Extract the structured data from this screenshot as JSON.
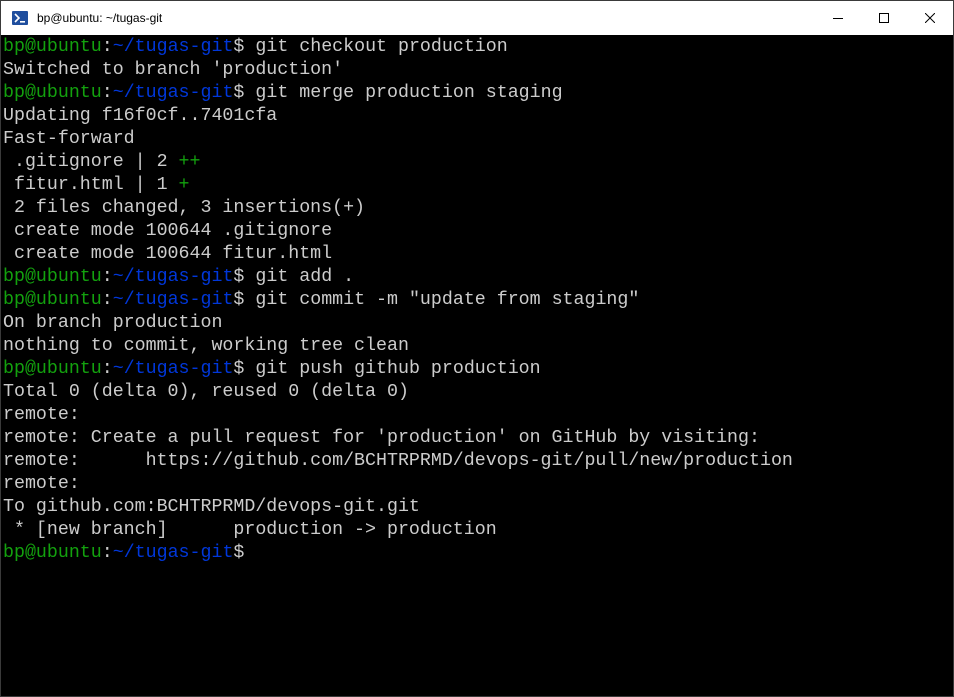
{
  "window": {
    "title": "bp@ubuntu: ~/tugas-git",
    "icon": "terminal-icon"
  },
  "prompt": {
    "user": "bp@ubuntu",
    "colon": ":",
    "path": "~/tugas-git",
    "symbol": "$"
  },
  "lines": [
    {
      "type": "cmd",
      "text": " git checkout production"
    },
    {
      "type": "out",
      "text": "Switched to branch 'production'"
    },
    {
      "type": "cmd",
      "text": " git merge production staging"
    },
    {
      "type": "out",
      "text": "Updating f16f0cf..7401cfa"
    },
    {
      "type": "out",
      "text": "Fast-forward"
    },
    {
      "type": "diff",
      "text": " .gitignore | 2 ",
      "plus": "++"
    },
    {
      "type": "diff",
      "text": " fitur.html | 1 ",
      "plus": "+"
    },
    {
      "type": "out",
      "text": " 2 files changed, 3 insertions(+)"
    },
    {
      "type": "out",
      "text": " create mode 100644 .gitignore"
    },
    {
      "type": "out",
      "text": " create mode 100644 fitur.html"
    },
    {
      "type": "cmd",
      "text": " git add ."
    },
    {
      "type": "cmd",
      "text": " git commit -m \"update from staging\""
    },
    {
      "type": "out",
      "text": "On branch production"
    },
    {
      "type": "out",
      "text": "nothing to commit, working tree clean"
    },
    {
      "type": "cmd",
      "text": " git push github production"
    },
    {
      "type": "out",
      "text": "Total 0 (delta 0), reused 0 (delta 0)"
    },
    {
      "type": "out",
      "text": "remote:"
    },
    {
      "type": "out",
      "text": "remote: Create a pull request for 'production' on GitHub by visiting:"
    },
    {
      "type": "out",
      "text": "remote:      https://github.com/BCHTRPRMD/devops-git/pull/new/production"
    },
    {
      "type": "out",
      "text": "remote:"
    },
    {
      "type": "out",
      "text": "To github.com:BCHTRPRMD/devops-git.git"
    },
    {
      "type": "out",
      "text": " * [new branch]      production -> production"
    },
    {
      "type": "cmd",
      "text": ""
    }
  ],
  "colors": {
    "background": "#000000",
    "text": "#cccccc",
    "user": "#13a10e",
    "path": "#0037da"
  }
}
